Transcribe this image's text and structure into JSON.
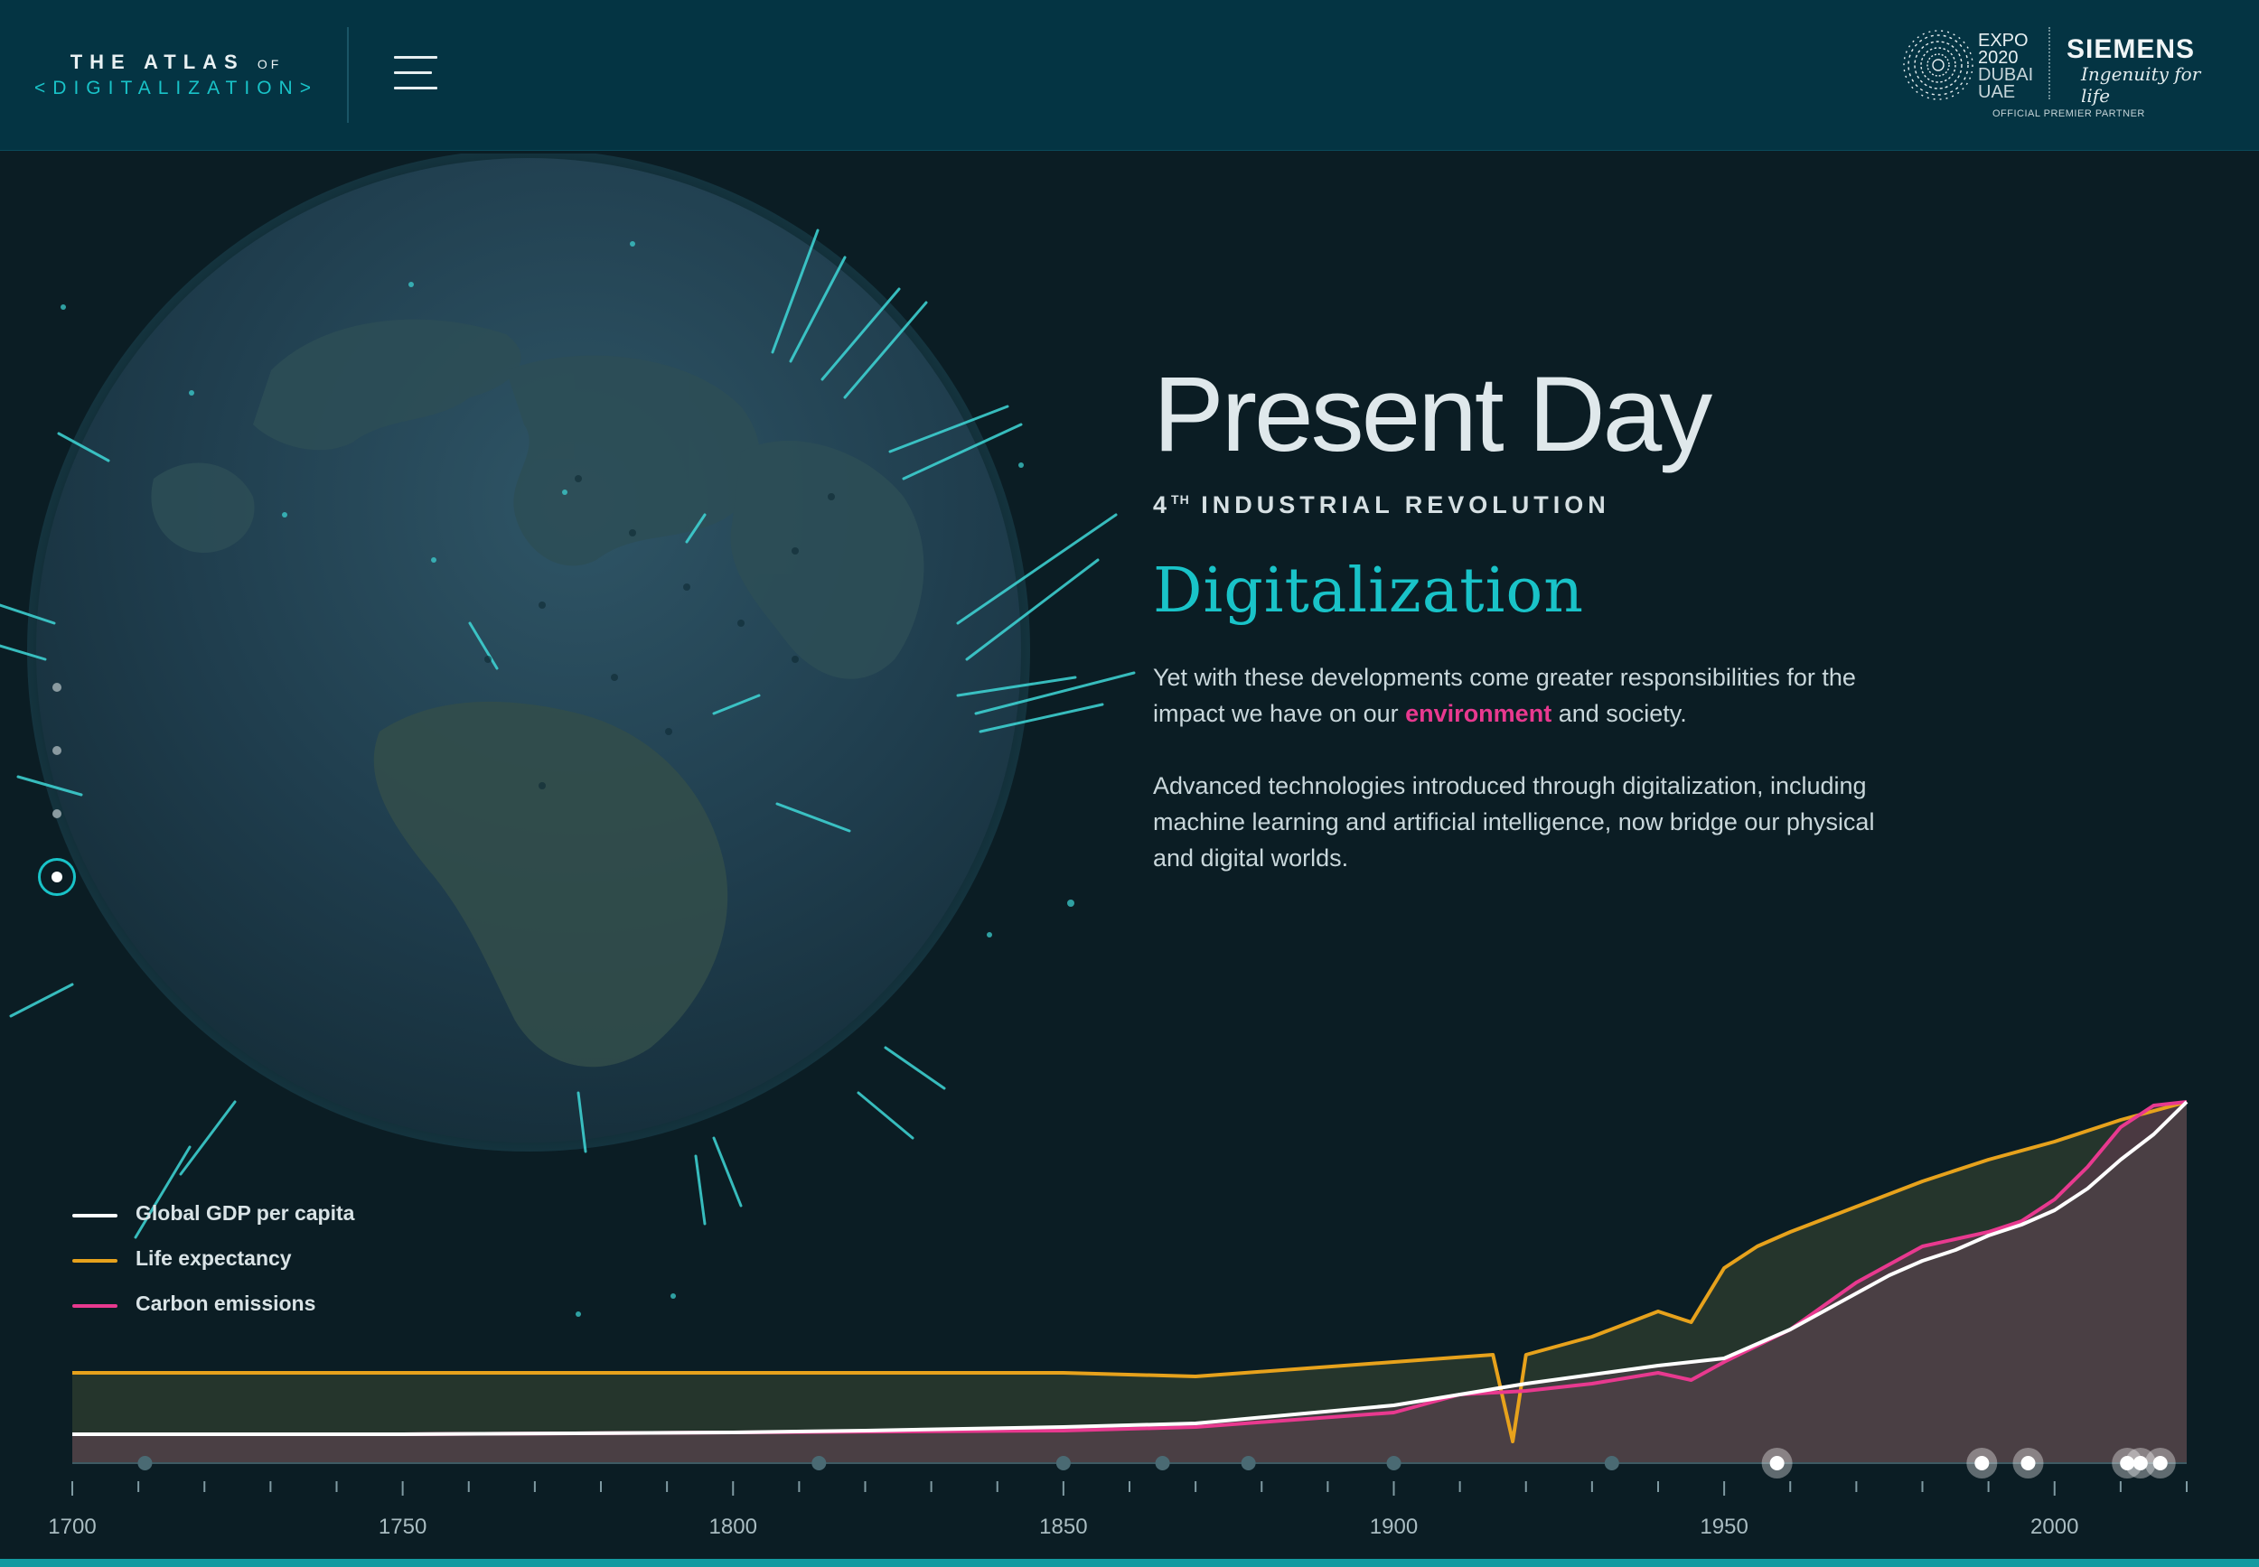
{
  "header": {
    "brand_top": "THE ATLAS",
    "brand_of": "OF",
    "brand_bottom": "<DIGITALIZATION>",
    "menu_icon": "hamburger-icon",
    "partner": {
      "expo_line1": "EXPO",
      "expo_line2": "2020",
      "expo_line3": "DUBAI",
      "expo_line4": "UAE",
      "siemens": "SIEMENS",
      "tagline": "Ingenuity for life",
      "official": "OFFICIAL PREMIER PARTNER"
    }
  },
  "section_nav": {
    "count": 4,
    "active_index": 3
  },
  "content": {
    "title": "Present Day",
    "era_num": "4",
    "era_sup": "TH",
    "era_text": "INDUSTRIAL REVOLUTION",
    "subtitle": "Digitalization",
    "para1_before": "Yet with these developments come greater responsibilities for the impact we have on our ",
    "para1_highlight": "environment",
    "para1_after": " and society.",
    "para2": "Advanced technologies introduced through digitalization, including machine learning and artificial intelligence, now bridge our physical and digital worlds."
  },
  "colors": {
    "accent": "#19c3c8",
    "highlight": "#e8398f",
    "gdp": "#ffffff",
    "life": "#e7a21c",
    "carbon": "#e8398f",
    "background": "#0b1d24",
    "header": "#043443"
  },
  "chart_data": {
    "type": "line",
    "title": "",
    "xlabel": "",
    "ylabel": "",
    "xlim": [
      1700,
      2020
    ],
    "ylim": [
      0,
      1
    ],
    "x_ticks": [
      1700,
      1750,
      1800,
      1850,
      1900,
      1950,
      2000
    ],
    "series": [
      {
        "name": "Global GDP per capita",
        "x": [
          1700,
          1750,
          1800,
          1820,
          1850,
          1870,
          1900,
          1920,
          1940,
          1950,
          1960,
          1970,
          1975,
          1980,
          1985,
          1990,
          1995,
          2000,
          2005,
          2010,
          2015,
          2020
        ],
        "values": [
          0.08,
          0.08,
          0.085,
          0.09,
          0.1,
          0.11,
          0.16,
          0.22,
          0.27,
          0.29,
          0.37,
          0.47,
          0.52,
          0.56,
          0.59,
          0.63,
          0.66,
          0.7,
          0.76,
          0.84,
          0.91,
          1.0
        ]
      },
      {
        "name": "Life expectancy",
        "x": [
          1700,
          1750,
          1800,
          1850,
          1870,
          1900,
          1915,
          1918,
          1920,
          1930,
          1940,
          1945,
          1950,
          1955,
          1960,
          1970,
          1980,
          1990,
          2000,
          2010,
          2020
        ],
        "values": [
          0.25,
          0.25,
          0.25,
          0.25,
          0.24,
          0.28,
          0.3,
          0.06,
          0.3,
          0.35,
          0.42,
          0.39,
          0.54,
          0.6,
          0.64,
          0.71,
          0.78,
          0.84,
          0.89,
          0.95,
          1.0
        ]
      },
      {
        "name": "Carbon emissions",
        "x": [
          1700,
          1750,
          1800,
          1850,
          1870,
          1900,
          1910,
          1920,
          1930,
          1940,
          1945,
          1950,
          1960,
          1970,
          1975,
          1980,
          1990,
          1995,
          2000,
          2005,
          2010,
          2015,
          2020
        ],
        "values": [
          0.08,
          0.08,
          0.085,
          0.09,
          0.1,
          0.14,
          0.19,
          0.2,
          0.22,
          0.25,
          0.23,
          0.28,
          0.37,
          0.5,
          0.55,
          0.6,
          0.64,
          0.67,
          0.73,
          0.82,
          0.93,
          0.99,
          1.0
        ]
      }
    ],
    "event_markers": [
      1711,
      1813,
      1850,
      1865,
      1878,
      1900,
      1933
    ],
    "highlight_markers": [
      1958,
      1989,
      1996,
      2011,
      2013,
      2016
    ],
    "legend_position": "bottom-left",
    "grid": false
  }
}
